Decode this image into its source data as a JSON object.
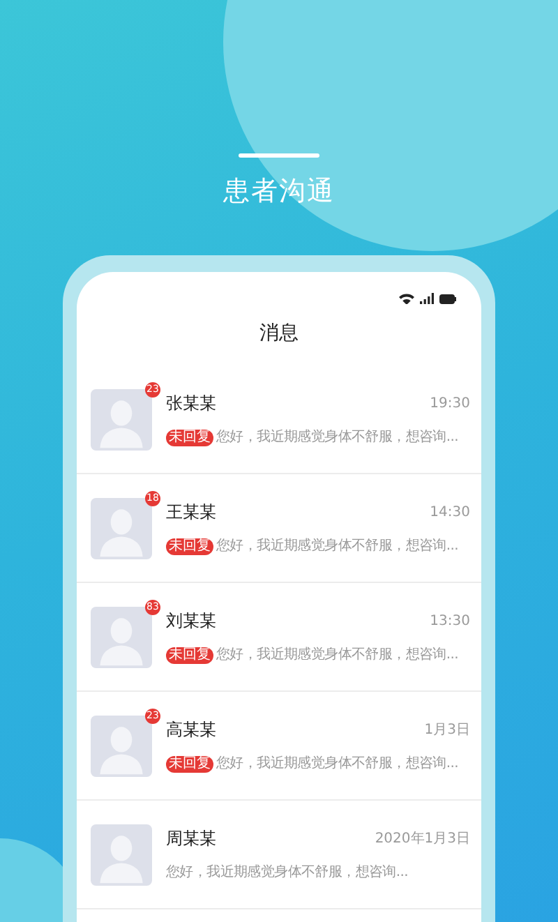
{
  "header": {
    "title": "患者沟通"
  },
  "phone": {
    "title": "消息",
    "conversations": [
      {
        "name": "张某某",
        "time": "19:30",
        "unread": "23",
        "tag": "未回复",
        "preview": "您好，我近期感觉身体不舒服，想咨询..."
      },
      {
        "name": "王某某",
        "time": "14:30",
        "unread": "18",
        "tag": "未回复",
        "preview": "您好，我近期感觉身体不舒服，想咨询..."
      },
      {
        "name": "刘某某",
        "time": "13:30",
        "unread": "83",
        "tag": "未回复",
        "preview": "您好，我近期感觉身体不舒服，想咨询..."
      },
      {
        "name": "高某某",
        "time": "1月3日",
        "unread": "23",
        "tag": "未回复",
        "preview": "您好，我近期感觉身体不舒服，想咨询..."
      },
      {
        "name": "周某某",
        "time": "2020年1月3日",
        "preview": "您好，我近期感觉身体不舒服，想咨询..."
      }
    ]
  }
}
